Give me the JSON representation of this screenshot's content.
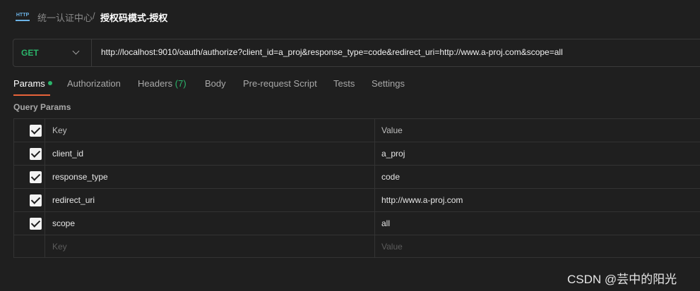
{
  "breadcrumb": {
    "icon_text": "HTTP",
    "parent": "统一认证中心",
    "separator": "/",
    "current": "授权码模式-授权"
  },
  "request": {
    "method": "GET",
    "url": "http://localhost:9010/oauth/authorize?client_id=a_proj&response_type=code&redirect_uri=http://www.a-proj.com&scope=all"
  },
  "tabs": [
    {
      "label": "Params",
      "active": true
    },
    {
      "label": "Authorization"
    },
    {
      "label": "Headers",
      "count": "(7)"
    },
    {
      "label": "Body"
    },
    {
      "label": "Pre-request Script"
    },
    {
      "label": "Tests"
    },
    {
      "label": "Settings"
    }
  ],
  "query_params": {
    "title": "Query Params",
    "headers": {
      "key": "Key",
      "value": "Value"
    },
    "rows": [
      {
        "key": "client_id",
        "value": "a_proj",
        "checked": true
      },
      {
        "key": "response_type",
        "value": "code",
        "checked": true
      },
      {
        "key": "redirect_uri",
        "value": "http://www.a-proj.com",
        "checked": true
      },
      {
        "key": "scope",
        "value": "all",
        "checked": true
      }
    ],
    "placeholder": {
      "key": "Key",
      "value": "Value"
    }
  },
  "watermark": "CSDN @芸中的阳光",
  "colors": {
    "accent": "#e8633a",
    "method": "#2bb56b",
    "background": "#1f1f1f"
  }
}
